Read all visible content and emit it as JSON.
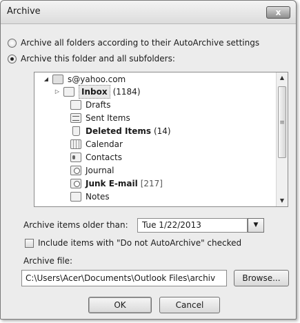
{
  "window": {
    "title": "Archive",
    "close_label": "x"
  },
  "options": {
    "archive_all_label": "Archive all folders according to their AutoArchive settings",
    "archive_this_label": "Archive this folder and all subfolders:",
    "selected": "archive_this"
  },
  "tree": {
    "account": "s@yahoo.com",
    "items": [
      {
        "name": "Inbox",
        "count": "(1184)",
        "bold": true,
        "icon": "inbox-icon"
      },
      {
        "name": "Drafts",
        "count": "",
        "bold": false,
        "icon": "drafts-icon"
      },
      {
        "name": "Sent Items",
        "count": "",
        "bold": false,
        "icon": "sent-items-icon"
      },
      {
        "name": "Deleted Items",
        "count": "(14)",
        "bold": true,
        "icon": "trash-icon"
      },
      {
        "name": "Calendar",
        "count": "",
        "bold": false,
        "icon": "calendar-icon"
      },
      {
        "name": "Contacts",
        "count": "",
        "bold": false,
        "icon": "contacts-icon"
      },
      {
        "name": "Journal",
        "count": "",
        "bold": false,
        "icon": "journal-icon"
      },
      {
        "name": "Junk E-mail",
        "count": "[217]",
        "bold": true,
        "icon": "junk-icon"
      },
      {
        "name": "Notes",
        "count": "",
        "bold": false,
        "icon": "notes-icon"
      }
    ]
  },
  "archive_older": {
    "label": "Archive items older than:",
    "value": "Tue 1/22/2013"
  },
  "include_checkbox": {
    "label": "Include items with \"Do not AutoArchive\" checked",
    "checked": false
  },
  "archive_file": {
    "label": "Archive file:",
    "value": "C:\\Users\\Acer\\Documents\\Outlook Files\\archiv",
    "browse_label": "Browse..."
  },
  "buttons": {
    "ok": "OK",
    "cancel": "Cancel"
  }
}
